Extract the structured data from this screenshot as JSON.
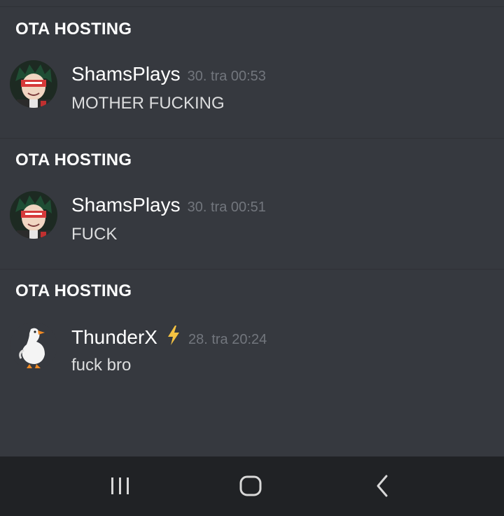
{
  "results": [
    {
      "channel": "OTA HOSTING",
      "author": "ShamsPlays",
      "timestamp": "30. tra 00:53",
      "message": "MOTHER FUCKING",
      "avatar": "anime-boy-avatar",
      "badge": null
    },
    {
      "channel": "OTA HOSTING",
      "author": "ShamsPlays",
      "timestamp": "30. tra 00:51",
      "message": "FUCK",
      "avatar": "anime-boy-avatar",
      "badge": null
    },
    {
      "channel": "OTA HOSTING",
      "author": "ThunderX",
      "timestamp": "28. tra 20:24",
      "message": "fuck bro",
      "avatar": "goose-avatar",
      "badge": "lightning-bolt-icon"
    }
  ],
  "navbar": {
    "buttons": [
      "recent-apps-icon",
      "home-icon",
      "back-icon"
    ]
  },
  "colors": {
    "background": "#36393f",
    "divider": "#2f3136",
    "username": "#ffffff",
    "timestamp": "#72767d",
    "message": "#dcddde",
    "navbar": "#202225",
    "bolt": "#f5c342"
  }
}
